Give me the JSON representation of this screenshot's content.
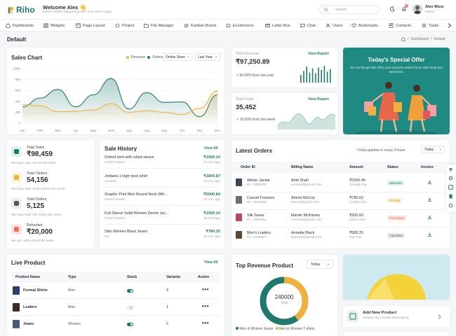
{
  "app": {
    "name": "Riho",
    "welcome": "Welcome Alex",
    "welcome_emoji": "👋",
    "subtitle": "Here's what's happening with your store today.",
    "search_placeholder": "Search",
    "notif_count": "4",
    "user_name": "Alex Mora",
    "user_role": "Admin"
  },
  "nav": [
    "Dashboards",
    "Widgets",
    "Page Layout",
    "Project",
    "File Manager",
    "Kanban Board",
    "Ecommerce",
    "Letter Box",
    "Chat",
    "Users",
    "Bookmarks",
    "Contacts",
    "Tasks"
  ],
  "page": {
    "title": "Default",
    "crumb_sep1": "/",
    "crumb_sep2": "/",
    "crumb1": "Dashboard",
    "crumb2": "Default"
  },
  "sales_chart": {
    "title": "Sales Chart",
    "legend": [
      "Revenue",
      "Orders"
    ],
    "filter1": "Online Store",
    "filter2": "Last Year"
  },
  "chart_data": {
    "type": "area",
    "categories": [
      "Jan",
      "Feb",
      "Mar",
      "Apr",
      "May",
      "June",
      "July",
      "Aug",
      "Sep",
      "Oct",
      "Nov",
      "Dec"
    ],
    "yticks": [
      "1000",
      "800",
      "600",
      "400",
      "200",
      "0"
    ],
    "ylim": [
      0,
      1000
    ],
    "series": [
      {
        "name": "Revenue",
        "color": "#f0b03e",
        "values": [
          340,
          320,
          210,
          220,
          240,
          360,
          200,
          230,
          200,
          160,
          270,
          590
        ]
      },
      {
        "name": "Orders",
        "color": "#1f7a6e",
        "values": [
          300,
          460,
          620,
          300,
          520,
          820,
          260,
          560,
          380,
          390,
          120,
          520
        ]
      }
    ]
  },
  "total_revenue": {
    "label": "Total Revenue",
    "value": "₹97,250.89",
    "delta": "60.00% from last year",
    "link": "View Report",
    "bars": [
      0.45,
      0.7,
      0.95,
      0.6,
      0.85,
      0.55,
      0.9,
      0.75,
      1.0,
      0.65,
      0.8
    ]
  },
  "total_order": {
    "label": "Total Order",
    "value": "35,452",
    "delta": "15.00% from last week",
    "link": "View Report"
  },
  "offer": {
    "title": "Today's Special Offer",
    "text": "You can flat get 20% off on your next pre version if your sale break your last record."
  },
  "stats": [
    {
      "label": "Total Sales",
      "value": "₹98,459",
      "note": "We have sale +18.2k this week.",
      "color": "#1f7a6e",
      "bg": "#e3f1ee"
    },
    {
      "label": "Total Visitors",
      "value": "54,156",
      "note": "We have total +3.5k visitors this week.",
      "color": "#f0b03e",
      "bg": "#fdf2dd"
    },
    {
      "label": "Total Orders",
      "value": "5,125",
      "note": "We have total +5k orders this week.",
      "color": "#555",
      "bg": "#ececec"
    },
    {
      "label": "Refunded",
      "value": "₹20,000",
      "note": "We got +66k refund this week.",
      "color": "#f07158",
      "bg": "#fde6e1"
    }
  ],
  "sale_history": {
    "title": "Sale History",
    "link": "View All",
    "rows": [
      {
        "name": "Oxford shirt with rolled sleeve",
        "loc": "United States",
        "price": "₹1500.14",
        "time": "10 min ago"
      },
      {
        "name": "Jordans 1 high neck tshirt",
        "loc": "Canada",
        "price": "₹1800.87",
        "time": "20 min ago"
      },
      {
        "name": "Graphic Print Men Round Neck Whi...",
        "loc": "United States",
        "price": "₹2000.84",
        "time": "40 min ago"
      },
      {
        "name": "Full Sleeve Solid Women Denim Jac...",
        "loc": "United States",
        "price": "₹1500.14",
        "time": "45 min ago"
      },
      {
        "name": "Slim Women Black Jeans",
        "loc": "UK",
        "price": "₹780.25",
        "time": "50 min ago"
      }
    ]
  },
  "latest_orders": {
    "title": "Latest Orders",
    "note": "Data updates in every 3 hours",
    "filter": "Today",
    "cols": [
      "Order ID",
      "Billing Name",
      "Amount",
      "Status",
      "Invoice"
    ],
    "rows": [
      {
        "item": "Winter Jacket",
        "id": "ID : #859578",
        "name": "Amit Shah",
        "email": "amit114@gmail.com",
        "amount": "₹1500.45",
        "method": "Google Pay",
        "status": "Delivered",
        "sc": "#1f7a6e",
        "sb": "#dff0ec",
        "thumb": "#3b4656"
      },
      {
        "item": "Casual Trousers",
        "id": "ID : #871966",
        "name": "Arlene McCoy",
        "email": "arlene@gmail.com",
        "amount": "₹785.62",
        "method": "Credit Card",
        "status": "Pending",
        "sc": "#d69a24",
        "sb": "#fcf0d8",
        "thumb": "#6e6e6e"
      },
      {
        "item": "Silk Saree",
        "id": "ID : #894561",
        "name": "Marvin McKinney",
        "email": "marvin4@gmail.com",
        "amount": "₹200.60",
        "method": "Debit Card",
        "status": "Processing",
        "sc": "#e0664d",
        "sb": "#fde4de",
        "thumb": "#b84a5a"
      },
      {
        "item": "Men's Loafers",
        "id": "ID : #234987",
        "name": "Annette Black",
        "email": "black45@gmail.com",
        "amount": "₹589.25",
        "method": "Pay Pal",
        "status": "Cancelled",
        "sc": "#555",
        "sb": "#e8e8e8",
        "thumb": "#5a4632"
      }
    ]
  },
  "live_product": {
    "title": "Live Product",
    "link": "View All",
    "cols": [
      "Product Name",
      "Type",
      "Stock",
      "Variants",
      "Action"
    ],
    "rows": [
      {
        "name": "Formal Shirts",
        "type": "Men",
        "stock": true,
        "variants": "3",
        "thumb": "#2b3f6e"
      },
      {
        "name": "Loafers",
        "type": "Men",
        "stock": false,
        "variants": "1",
        "thumb": "#3a2a22"
      },
      {
        "name": "Jeans",
        "type": "Women",
        "stock": true,
        "variants": "2",
        "thumb": "#4a5a7a"
      }
    ]
  },
  "top_revenue": {
    "title": "Top Revenue Product",
    "filter": "Today",
    "total": "240000",
    "total_label": "Total",
    "legend": [
      "Men & Women Jeans",
      "Men & Women T-shirts"
    ],
    "colors": [
      "#1f7a6e",
      "#f0b03e"
    ],
    "share": [
      0.6,
      0.4
    ]
  },
  "add_product": {
    "title": "Add New Product",
    "text": "Images are crucial showcasing"
  }
}
